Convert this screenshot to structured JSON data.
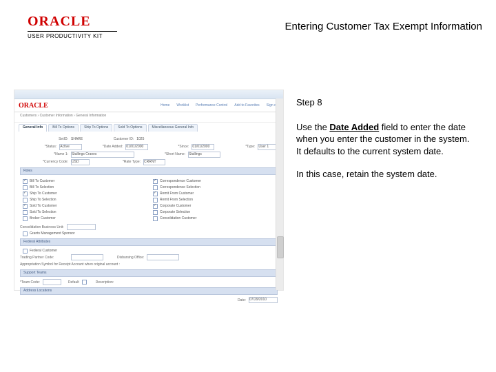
{
  "header": {
    "brand_main": "ORACLE",
    "brand_sub": "USER PRODUCTIVITY KIT",
    "doc_title": "Entering Customer Tax Exempt Information"
  },
  "instruction": {
    "step": "Step 8",
    "p1_a": "Use the ",
    "p1_bold": "Date Added",
    "p1_b": " field to enter the date when you enter the customer in the system. It defaults to the current system date.",
    "p2": "In this case, retain the system date."
  },
  "shot": {
    "brand": "ORACLE",
    "nav": [
      "Home",
      "Worklist",
      "Performance Control",
      "Add to Favorites",
      "Sign out"
    ],
    "crumbs": "Customers  ›  Customer Information  ›  General Information",
    "tabs": [
      "General Info",
      "Bill To Options",
      "Ship To Options",
      "Sold To Options",
      "Miscellaneous General Info"
    ],
    "form": {
      "setid_lab": "SetID:",
      "setid_val": "SHARE",
      "custid_lab": "Customer ID:",
      "custid_val": "1025",
      "status_lab": "*Status:",
      "status_val": "Active",
      "date_lab": "*Date Added:",
      "date_val": "01/01/2000",
      "since_lab": "*Since:",
      "since_val": "01/01/2000",
      "type_lab": "*Type:",
      "type_val": "User 1",
      "name1_lab": "*Name 1:",
      "name1_val": "Stallings Cranes",
      "short_lab": "*Short Name:",
      "short_val": "Stallings",
      "curr_lab": "*Currency Code:",
      "curr_val": "USD",
      "rate_lab": "*Rate Type:",
      "rate_val": "CRRNT"
    },
    "section_roles": "Roles",
    "roles_left": [
      "Bill To Customer",
      "Bill To Selection",
      "Ship To Customer",
      "Ship To Selection",
      "Sold To Customer",
      "Sold To Selection",
      "Broker Customer"
    ],
    "roles_right": [
      "Correspondence Customer",
      "Correspondence Selection",
      "Remit From Customer",
      "Remit From Selection",
      "Corporate Customer",
      "Corporate Selection",
      "Consolidation Customer"
    ],
    "cons_lab": "Consolidation Business Unit:",
    "gm_lab": "Grants Management Sponsor",
    "section_fed": "Federal Attributes",
    "fed_cust": "Federal Customer",
    "tpc_lab": "Trading Partner Code:",
    "disb_lab": "Disbursing Office:",
    "agg_lab": "Appropriation Symbol for Receipt Account when original account :",
    "section_support": "Support Teams",
    "team_lab": "*Team Code:",
    "default_lab": "Default",
    "desc_lab": "Description:",
    "section_addr": "Address Locations",
    "addr_date_lab": "Date:",
    "addr_date_val": "07/29/2010"
  }
}
